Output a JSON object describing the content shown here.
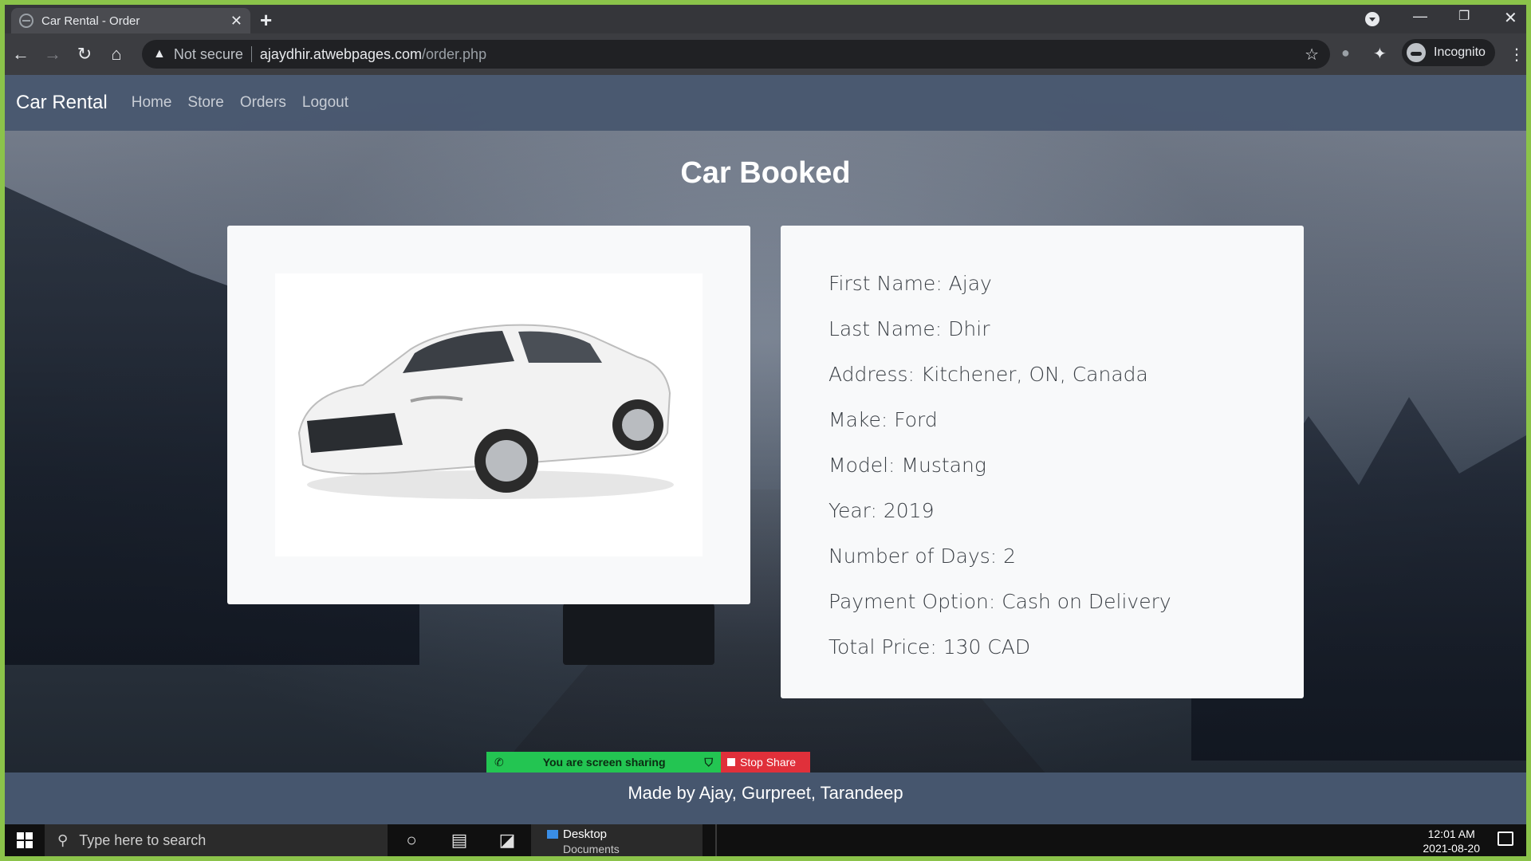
{
  "browser": {
    "tab_title": "Car Rental - Order",
    "tab_close": "✕",
    "new_tab": "+",
    "security_label": "Not secure",
    "url_host": "ajaydhir.atwebpages.com",
    "url_path": "/order.php",
    "profile_label": "Incognito",
    "window_controls": {
      "minimize": "—",
      "restore": "❐",
      "close": "✕"
    },
    "nav_icons": {
      "back": "←",
      "forward": "→",
      "reload": "↻",
      "home": "⌂",
      "bookmark": "☆",
      "extensions": "✦",
      "menu": "⋮"
    }
  },
  "site": {
    "brand": "Car Rental",
    "nav": [
      {
        "label": "Home"
      },
      {
        "label": "Store"
      },
      {
        "label": "Orders"
      },
      {
        "label": "Logout"
      }
    ],
    "heading": "Car Booked",
    "car_image_alt": "white Ford Mustang",
    "order": [
      {
        "label": "First Name: Ajay"
      },
      {
        "label": "Last Name: Dhir"
      },
      {
        "label": "Address: Kitchener, ON, Canada"
      },
      {
        "label": "Make: Ford"
      },
      {
        "label": "Model: Mustang"
      },
      {
        "label": "Year: 2019"
      },
      {
        "label": "Number of Days: 2"
      },
      {
        "label": "Payment Option: Cash on Delivery"
      },
      {
        "label": "Total Price: 130 CAD"
      }
    ],
    "footer": "Made by Ajay, Gurpreet, Tarandeep"
  },
  "screen_share": {
    "status": "You are screen sharing",
    "stop_label": "Stop Share"
  },
  "taskbar": {
    "search_placeholder": "Type here to search",
    "pinned_label": "Desktop",
    "pinned_sub": "Documents",
    "time": "12:01 AM",
    "date": "2021-08-20"
  },
  "colors": {
    "navbar": "#46566e",
    "card": "#f8f9fa",
    "share_green": "#23c552",
    "share_red": "#e0303a",
    "outer_border": "#8bc34a"
  }
}
